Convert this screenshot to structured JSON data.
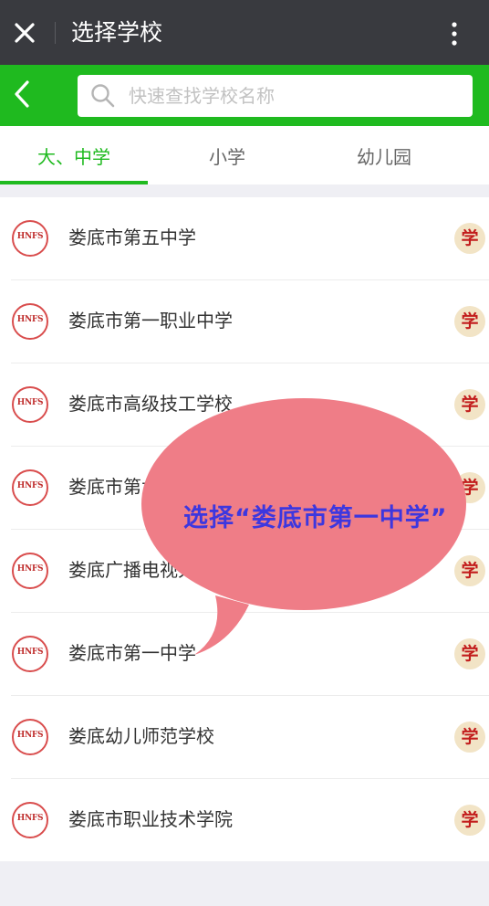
{
  "header": {
    "title": "选择学校",
    "close_icon": "close-icon",
    "more_icon": "more-vertical-icon"
  },
  "search": {
    "back_icon": "chevron-left-icon",
    "search_icon": "search-icon",
    "placeholder": "快速查找学校名称"
  },
  "tabs": [
    {
      "label": "大、中学",
      "active": true
    },
    {
      "label": "小学",
      "active": false
    },
    {
      "label": "幼儿园",
      "active": false
    }
  ],
  "schools": [
    {
      "logo": "HNFS",
      "name": "娄底市第五中学",
      "badge": "学"
    },
    {
      "logo": "HNFS",
      "name": "娄底市第一职业中学",
      "badge": "学"
    },
    {
      "logo": "HNFS",
      "name": "娄底市高级技工学校",
      "badge": "学"
    },
    {
      "logo": "HNFS",
      "name": "娄底市第六中学",
      "badge": "学"
    },
    {
      "logo": "HNFS",
      "name": "娄底广播电视大学",
      "badge": "学"
    },
    {
      "logo": "HNFS",
      "name": "娄底市第一中学",
      "badge": "学"
    },
    {
      "logo": "HNFS",
      "name": "娄底幼儿师范学校",
      "badge": "学"
    },
    {
      "logo": "HNFS",
      "name": "娄底市职业技术学院",
      "badge": "学"
    }
  ],
  "annotation": {
    "text": "选择“娄底市第一中学”"
  },
  "colors": {
    "accent": "#1fba1f",
    "titlebar": "#393a3f",
    "bubble": "#ef7d87",
    "bubble_text": "#3d37df",
    "logo_red": "#c0302f"
  }
}
